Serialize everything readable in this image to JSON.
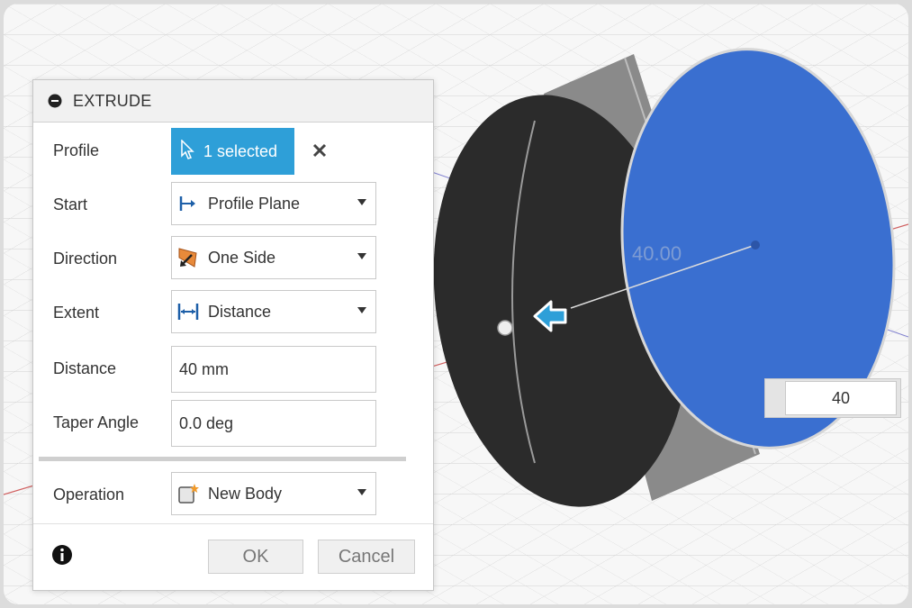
{
  "dialog": {
    "title": "EXTRUDE",
    "rows": [
      {
        "label": "Profile",
        "value": "1 selected",
        "icon": "cursor-arrow-icon"
      },
      {
        "label": "Start",
        "value": "Profile Plane",
        "icon": "profile-plane-icon"
      },
      {
        "label": "Direction",
        "value": "One Side",
        "icon": "one-side-icon"
      },
      {
        "label": "Extent",
        "value": "Distance",
        "icon": "distance-icon"
      },
      {
        "label": "Distance",
        "value": "40 mm"
      },
      {
        "label": "Taper Angle",
        "value": "0.0 deg"
      },
      {
        "label": "Operation",
        "value": "New Body",
        "icon": "new-body-icon"
      }
    ],
    "ok_label": "OK",
    "cancel_label": "Cancel"
  },
  "viewport": {
    "dimension_label": "40.00",
    "distance_input_value": "40"
  },
  "colors": {
    "accent": "#2e9fd8",
    "profile_face": "#3a6fd0",
    "body_dark": "#2b2b2b",
    "grid": "#c8c8c8"
  }
}
